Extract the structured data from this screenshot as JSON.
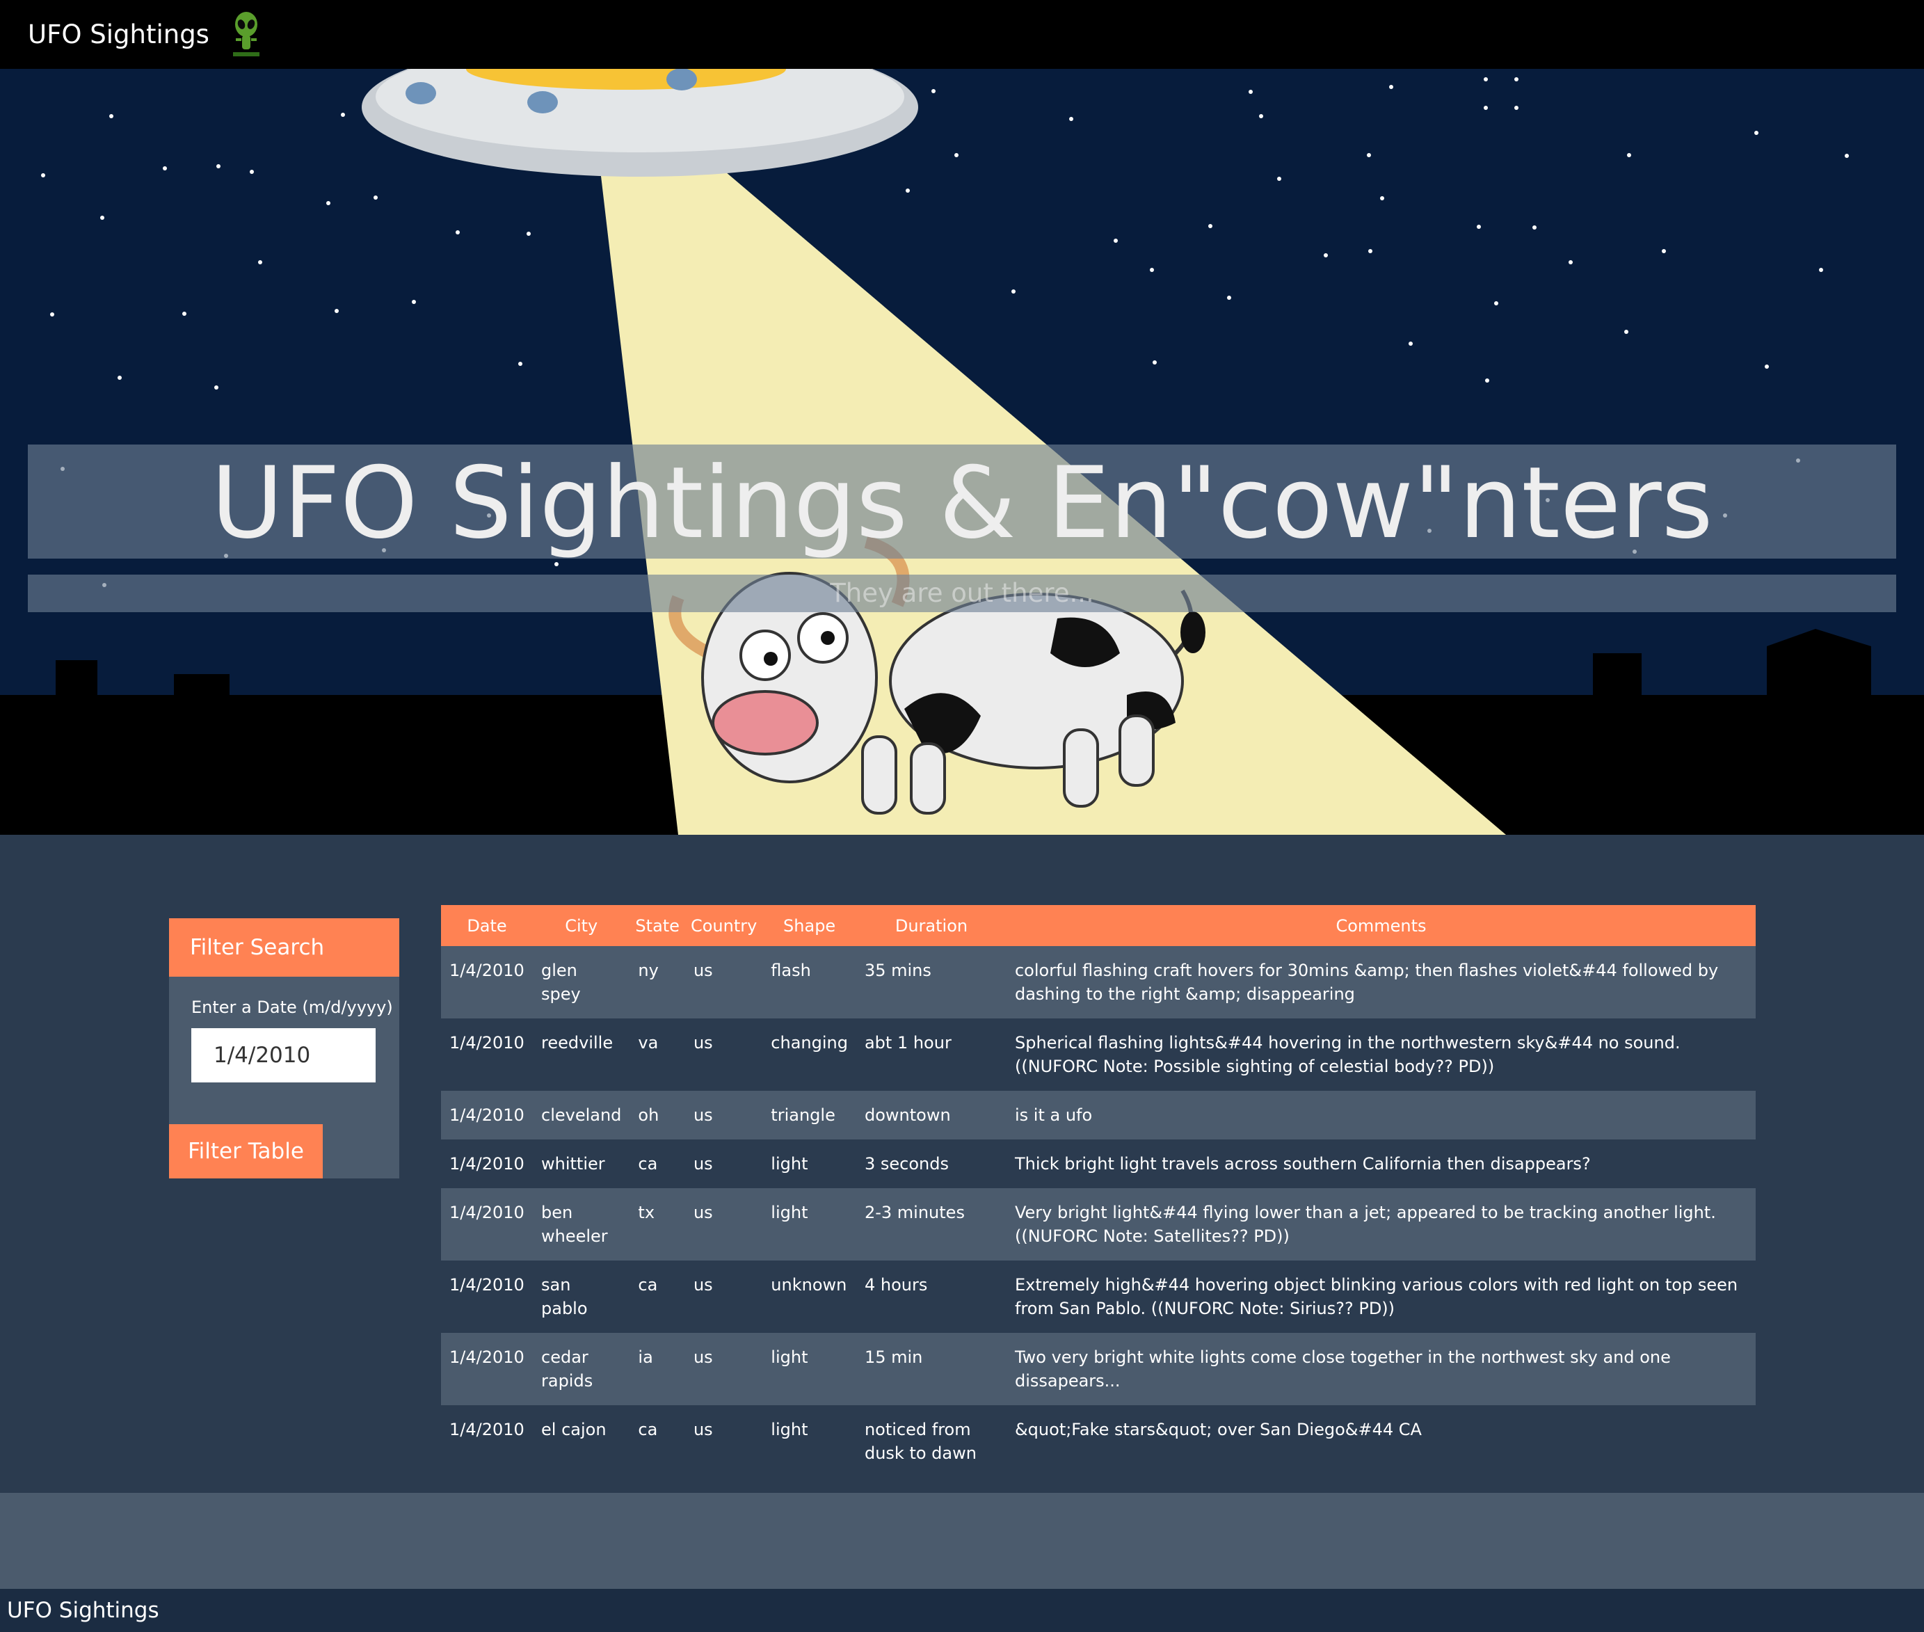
{
  "navbar": {
    "brand": "UFO Sightings"
  },
  "hero": {
    "title": "UFO Sightings & En\"cow\"nters",
    "subtitle": "They are out there..."
  },
  "filter": {
    "header": "Filter Search",
    "label": "Enter a Date (m/d/yyyy)",
    "date_value": "1/4/2010",
    "date_placeholder": "1/4/2010",
    "button": "Filter Table"
  },
  "table": {
    "headers": [
      "Date",
      "City",
      "State",
      "Country",
      "Shape",
      "Duration",
      "Comments"
    ],
    "rows": [
      [
        "1/4/2010",
        "glen spey",
        "ny",
        "us",
        "flash",
        "35 mins",
        "colorful flashing craft hovers for 30mins &amp; then flashes violet&#44 followed by dashing to the right &amp; disappearing"
      ],
      [
        "1/4/2010",
        "reedville",
        "va",
        "us",
        "changing",
        "abt 1 hour",
        "Spherical flashing lights&#44 hovering in the northwestern sky&#44 no sound. ((NUFORC Note: Possible sighting of celestial body?? PD))"
      ],
      [
        "1/4/2010",
        "cleveland",
        "oh",
        "us",
        "triangle",
        "downtown",
        "is it a ufo"
      ],
      [
        "1/4/2010",
        "whittier",
        "ca",
        "us",
        "light",
        "3 seconds",
        "Thick bright light travels across southern California then disappears?"
      ],
      [
        "1/4/2010",
        "ben wheeler",
        "tx",
        "us",
        "light",
        "2-3 minutes",
        "Very bright light&#44 flying lower than a jet; appeared to be tracking another light. ((NUFORC Note: Satellites?? PD))"
      ],
      [
        "1/4/2010",
        "san pablo",
        "ca",
        "us",
        "unknown",
        "4 hours",
        "Extremely high&#44 hovering object blinking various colors with red light on top seen from San Pablo. ((NUFORC Note: Sirius?? PD))"
      ],
      [
        "1/4/2010",
        "cedar rapids",
        "ia",
        "us",
        "light",
        "15 min",
        "Two very bright white lights come close together in the northwest sky and one dissapears..."
      ],
      [
        "1/4/2010",
        "el cajon",
        "ca",
        "us",
        "light",
        "noticed from dusk to dawn",
        "&quot;Fake stars&quot; over San Diego&#44 CA"
      ]
    ]
  },
  "footer": {
    "text": "UFO Sightings"
  },
  "colors": {
    "accent": "#ff8253",
    "navbar": "#000000",
    "main_bg": "#2b3b4f",
    "panel": "#4b5b6d",
    "footer": "#1b2c42"
  },
  "icons": {
    "nav_logo": "alien-icon"
  }
}
